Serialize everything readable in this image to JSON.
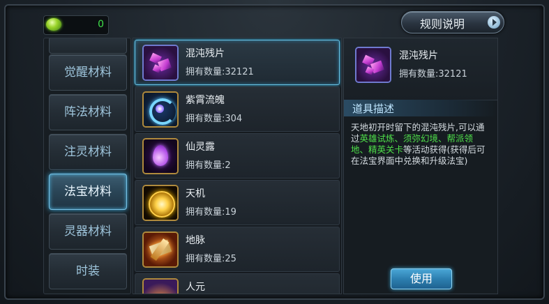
{
  "currency": {
    "icon": "green-gem-icon",
    "value": "0"
  },
  "rules_button": {
    "label": "规则说明",
    "icon": "arrow-right-icon"
  },
  "categories": [
    {
      "label": "觉醒材料",
      "active": false
    },
    {
      "label": "阵法材料",
      "active": false
    },
    {
      "label": "注灵材料",
      "active": false
    },
    {
      "label": "法宝材料",
      "active": true
    },
    {
      "label": "灵器材料",
      "active": false
    },
    {
      "label": "时装",
      "active": false
    }
  ],
  "items": [
    {
      "name": "混沌残片",
      "count": "拥有数量:32121",
      "icon": "chaos-shard-icon",
      "selected": true
    },
    {
      "name": "紫霄流魄",
      "count": "拥有数量:304",
      "icon": "purple-swirl-icon",
      "selected": false
    },
    {
      "name": "仙灵露",
      "count": "拥有数量:2",
      "icon": "spirit-dew-icon",
      "selected": false
    },
    {
      "name": "天机",
      "count": "拥有数量:19",
      "icon": "golden-orb-icon",
      "selected": false
    },
    {
      "name": "地脉",
      "count": "拥有数量:25",
      "icon": "earth-vein-icon",
      "selected": false
    },
    {
      "name": "人元",
      "count": "",
      "icon": "human-essence-icon",
      "selected": false
    }
  ],
  "detail": {
    "name": "混沌残片",
    "count": "拥有数量:32121",
    "icon": "chaos-shard-icon",
    "desc_title": "道具描述",
    "desc_parts": [
      {
        "text": "天地初开时留下的混沌残片,可以通过",
        "highlight": false
      },
      {
        "text": "英雄试炼、须弥幻境、帮派领地、精英关卡",
        "highlight": true
      },
      {
        "text": "等活动获得(获得后可在法宝界面中兑换和升级法宝)",
        "highlight": false
      }
    ],
    "use_label": "使用"
  },
  "colors": {
    "highlight": "#4fe04a",
    "selected_border": "#6bc4e6",
    "currency_text": "#3fe04a"
  }
}
